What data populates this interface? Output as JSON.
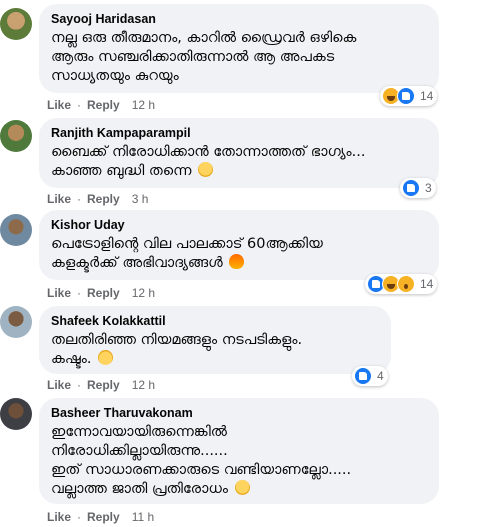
{
  "labels": {
    "like": "Like",
    "reply": "Reply"
  },
  "comments": [
    {
      "author": "Sayooj Haridasan",
      "text": "നല്ല ഒരു തീരുമാനം, കാറിൽ ഡ്രൈവർ ഒഴികെ\nആരും സഞ്ചരിക്കാതിരുന്നാൽ ആ അപകട\nസാധ്യതയും കുറയും",
      "emoji": "",
      "time": "12 h",
      "reactions": [
        "haha",
        "like"
      ],
      "reaction_count": "14"
    },
    {
      "author": "Ranjith Kampaparampil",
      "text": "ബൈക്ക് നിരോധിക്കാൻ തോന്നാത്തത് ഭാഗ്യം...\nകാഞ്ഞ ബുദ്ധി തന്നെ",
      "emoji": "smile-emoji",
      "time": "3 h",
      "reactions": [
        "like"
      ],
      "reaction_count": "3"
    },
    {
      "author": "Kishor Uday",
      "text": "പെട്രോളിന്റെ വില പാലക്കാട് 60ആക്കിയ\nകളക്ടർക്ക് അഭിവാദ്യങ്ങൾ",
      "emoji": "fire-emoji",
      "time": "12 h",
      "reactions": [
        "like",
        "haha",
        "wow"
      ],
      "reaction_count": "14"
    },
    {
      "author": "Shafeek Kolakkattil",
      "text": "തലതിരിഞ്ഞ നിയമങ്ങളും നടപടികളും.\nകഷ്ടം.",
      "emoji": "upside-down-emoji",
      "time": "12 h",
      "reactions": [
        "like"
      ],
      "reaction_count": "4"
    },
    {
      "author": "Basheer Tharuvakonam",
      "text": "ഇന്നോവയായിരുന്നെങ്കിൽ\nനിരോധിക്കില്ലായിരുന്നു......\nഇത് സാധാരണക്കാരുടെ വണ്ടിയാണല്ലോ.....\nവല്ലാത്ത ജാതി പ്രതിരോധം",
      "emoji": "grin-emoji",
      "time": "11 h",
      "reactions": [],
      "reaction_count": ""
    }
  ],
  "colors": {
    "bubble": "#f0f2f5",
    "meta": "#65676b",
    "like_blue": "#1877f2",
    "emoji_yellow": "#f7b125"
  }
}
